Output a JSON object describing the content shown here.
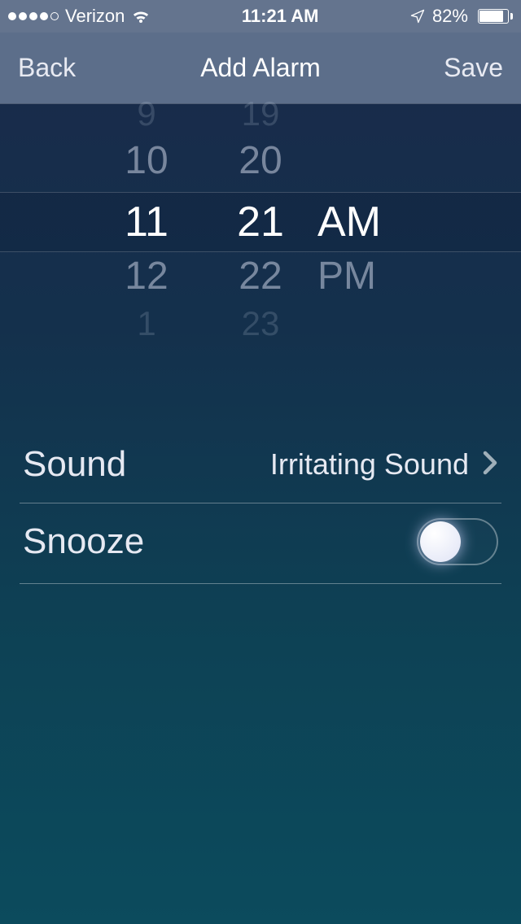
{
  "status": {
    "carrier": "Verizon",
    "time": "11:21 AM",
    "battery_pct": "82%"
  },
  "nav": {
    "back": "Back",
    "title": "Add Alarm",
    "save": "Save"
  },
  "picker": {
    "hours": [
      "9",
      "10",
      "11",
      "12",
      "1"
    ],
    "minutes": [
      "19",
      "20",
      "21",
      "22",
      "23"
    ],
    "periods": [
      "",
      "",
      "AM",
      "PM",
      ""
    ]
  },
  "settings": {
    "sound_label": "Sound",
    "sound_value": "Irritating Sound",
    "snooze_label": "Snooze",
    "snooze_on": false
  }
}
